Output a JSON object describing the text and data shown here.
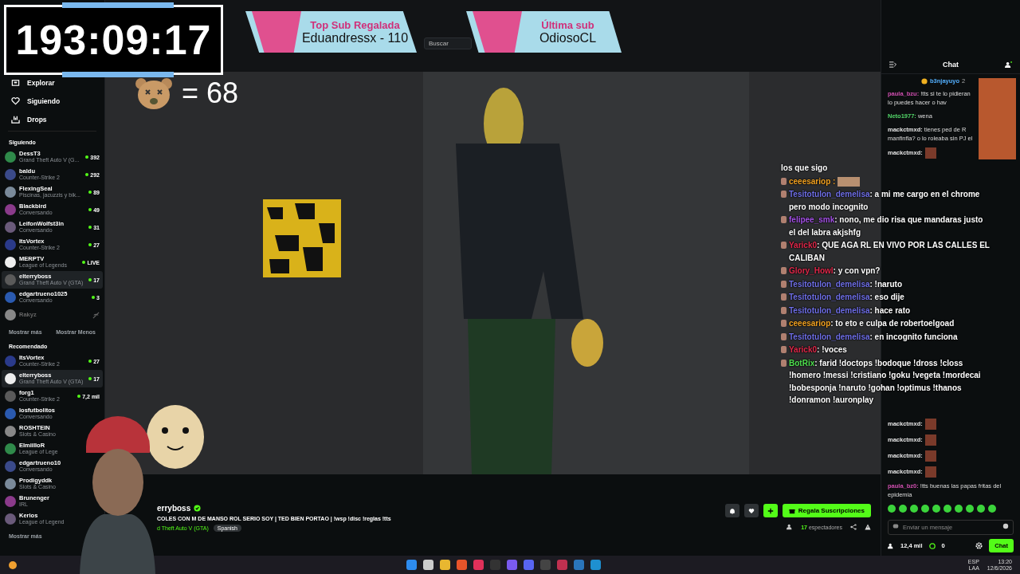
{
  "browser": {
    "search_placeholder": "Buscar"
  },
  "overlays": {
    "timer": "193:09:17",
    "top_sub": {
      "title": "Top Sub Regalada",
      "value": "Eduandressx - 110"
    },
    "last_sub": {
      "title": "Última sub",
      "value": "OdiosoCL"
    },
    "counter": "= 68"
  },
  "sidebar": {
    "nav": [
      {
        "kind": "explore",
        "label": "Explorar"
      },
      {
        "kind": "following",
        "label": "Siguiendo"
      },
      {
        "kind": "drops",
        "label": "Drops"
      }
    ],
    "following_title": "Siguiendo",
    "following": [
      {
        "name": "DessT3",
        "category": "Grand Theft Auto V (G...",
        "viewers": "392",
        "live": true,
        "selected": false
      },
      {
        "name": "baldu",
        "category": "Counter-Strike 2",
        "viewers": "292",
        "live": true,
        "selected": false
      },
      {
        "name": "FlexingSeal",
        "category": "Piscinas, jacuzzis y bik...",
        "viewers": "89",
        "live": true,
        "selected": false
      },
      {
        "name": "Blackbird",
        "category": "Conversando",
        "viewers": "49",
        "live": true,
        "selected": false
      },
      {
        "name": "LeifonWolfst3in",
        "category": "Conversando",
        "viewers": "31",
        "live": true,
        "selected": false
      },
      {
        "name": "ItsVortex",
        "category": "Counter-Strike 2",
        "viewers": "27",
        "live": true,
        "selected": false
      },
      {
        "name": "MERPTV",
        "category": "League of Legends",
        "viewers": "LIVE",
        "live": true,
        "selected": false
      },
      {
        "name": "elterryboss",
        "category": "Grand Theft Auto V (GTA)",
        "viewers": "17",
        "live": true,
        "selected": true
      },
      {
        "name": "edgartrueno1025",
        "category": "Conversando",
        "viewers": "3",
        "live": true,
        "selected": false
      },
      {
        "name": "Rakyz",
        "live": false,
        "selected": false
      }
    ],
    "show_more": "Mostrar más",
    "show_less": "Mostrar Menos",
    "recommended_title": "Recomendado",
    "recommended": [
      {
        "name": "ItsVortex",
        "category": "Counter-Strike 2",
        "viewers": "27",
        "live": true,
        "selected": false
      },
      {
        "name": "elterryboss",
        "category": "Grand Theft Auto V (GTA)",
        "viewers": "17",
        "live": true,
        "selected": true
      },
      {
        "name": "forg1",
        "category": "Counter-Strike 2",
        "viewers": "7,2 mil",
        "live": true,
        "selected": false
      },
      {
        "name": "losfutbolitos",
        "category": "Conversando",
        "selected": false
      },
      {
        "name": "ROSHTEIN",
        "category": "Slots & Casino",
        "selected": false
      },
      {
        "name": "ElmiilloR",
        "category": "League of Lege",
        "selected": false
      },
      {
        "name": "edgartrueno10",
        "category": "Conversando",
        "selected": false
      },
      {
        "name": "Prodigyddk",
        "category": "Slots & Casino",
        "selected": false
      },
      {
        "name": "Brunenger",
        "category": "IRL",
        "selected": false
      },
      {
        "name": "Kerios",
        "category": "League of Legend",
        "selected": false
      }
    ],
    "footer_more": "Mostrar más"
  },
  "stream": {
    "channel": "erryboss",
    "verified": true,
    "title": "COLES CON M DE MANSO ROL SERIO SOY | TED BIEN PORTAO | !wsp !disc !reglas !tts",
    "category": "d Theft Auto V (GTA)",
    "tag": "Spanish",
    "viewers": "17",
    "viewers_label": "espectadores",
    "subscribe_button": "Regala Suscripciones"
  },
  "chat": {
    "title": "Chat",
    "pinned": {
      "user": "b3njayuyo",
      "count": "2"
    },
    "messages_top": [
      {
        "kind": "text",
        "user": "paula_bzu:",
        "color": "#d04fb0",
        "text": "!tts si te lo pidieran lo puedes hacer o hav"
      },
      {
        "kind": "text",
        "user": "Neto1977:",
        "color": "#53d769",
        "text": "wena"
      },
      {
        "kind": "text",
        "user": "mackctmxd:",
        "text": "tienes ped de R manfinfla? o lo roleaba sin PJ el"
      },
      {
        "kind": "emote",
        "user": "mackctmxd:"
      }
    ],
    "messages_bottom": [
      {
        "kind": "emote",
        "user": "mackctmxd:"
      },
      {
        "kind": "emote",
        "user": "mackctmxd:"
      },
      {
        "kind": "emote",
        "user": "mackctmxd:"
      },
      {
        "kind": "emote",
        "user": "mackctmxd:"
      },
      {
        "kind": "text",
        "user": "paula_bz0:",
        "color": "#d04fb0",
        "text": "!tts buenas las papas fritas del epidemia"
      }
    ],
    "input_placeholder": "Enviar un mensaje",
    "viewers": "12,4 mil",
    "points": "0",
    "send_button": "Chat"
  },
  "overlay_chat": [
    {
      "kind": "continuation",
      "text": "los que sigo"
    },
    {
      "kind": "emote",
      "user": "ceeesariop :",
      "color": "#f0a020"
    },
    {
      "kind": "message",
      "user": "Tesitotulon_demelisa",
      "color": "#6f6fe8",
      "text": ": a mi me cargo en el chrome pero modo incognito"
    },
    {
      "kind": "message",
      "user": "felipee_smk",
      "color": "#a451e6",
      "text": ": nono, me dio risa que mandaras justo el del labra akjshfg"
    },
    {
      "kind": "message",
      "user": "Yarick0",
      "color": "#e0284a",
      "text": ": QUE AGA RL EN VIVO POR LAS CALLES EL CALIBAN"
    },
    {
      "kind": "message",
      "user": "Glory_Howl",
      "color": "#e0284a",
      "text": ": y con vpn?"
    },
    {
      "kind": "message",
      "user": "Tesitotulon_demelisa",
      "color": "#6f6fe8",
      "text": ": !naruto"
    },
    {
      "kind": "message",
      "user": "Tesitotulon_demelisa",
      "color": "#6f6fe8",
      "text": ": eso dije"
    },
    {
      "kind": "message",
      "user": "Tesitotulon_demelisa",
      "color": "#6f6fe8",
      "text": ": hace rato"
    },
    {
      "kind": "message",
      "user": "ceeesariop",
      "color": "#f0a020",
      "text": ": to eto e culpa de robertoelgoad"
    },
    {
      "kind": "message",
      "user": "Tesitotulon_demelisa",
      "color": "#6f6fe8",
      "text": ": en incognito funciona"
    },
    {
      "kind": "message",
      "user": "Yarick0",
      "color": "#e0284a",
      "text": ": !voces"
    },
    {
      "kind": "message",
      "user": "BotRix",
      "color": "#4fe04f",
      "text": ": farid !doctops !bodoque !dross !closs !homero !messi !cristiano !goku !vegeta !mordecai !bobesponja !naruto !gohan !optimus !thanos !donramon !auronplay"
    }
  ],
  "taskbar": {
    "language": "ESP",
    "layout": "LAA",
    "time": "13:20",
    "date": "12/6/2026"
  }
}
